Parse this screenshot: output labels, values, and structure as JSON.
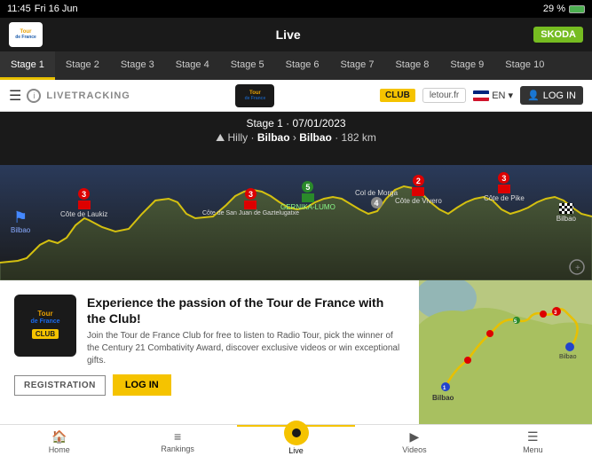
{
  "statusBar": {
    "time": "11:45",
    "day": "Fri 16 Jun",
    "battery": "29 %",
    "signal": "wifi"
  },
  "topNav": {
    "liveLabel": "Live",
    "skodaLabel": "SKODA"
  },
  "stageTabs": {
    "tabs": [
      {
        "label": "Stage 1",
        "active": true
      },
      {
        "label": "Stage 2",
        "active": false
      },
      {
        "label": "Stage 3",
        "active": false
      },
      {
        "label": "Stage 4",
        "active": false
      },
      {
        "label": "Stage 5",
        "active": false
      },
      {
        "label": "Stage 6",
        "active": false
      },
      {
        "label": "Stage 7",
        "active": false
      },
      {
        "label": "Stage 8",
        "active": false
      },
      {
        "label": "Stage 9",
        "active": false
      },
      {
        "label": "Stage 10",
        "active": false
      }
    ]
  },
  "subNav": {
    "livetracking": "LIVETRACKING",
    "club": "CLUB",
    "letour": "letour.fr",
    "lang": "EN",
    "login": "LOG IN"
  },
  "profileSection": {
    "stageInfo": "Stage 1 · 07/01/2023",
    "terrain": "Hilly",
    "from": "Bilbao",
    "to": "Bilbao",
    "distance": "182 km",
    "climbs": [
      {
        "label": "Bilbao",
        "type": "start",
        "left": "3%"
      },
      {
        "label": "Côte de Laukiz",
        "cat": "3",
        "left": "12%"
      },
      {
        "label": "Côte de San Juan de Gaztelugatxe",
        "cat": "3",
        "left": "37%"
      },
      {
        "label": "GERNIKA-LUMO",
        "cat": "s5",
        "left": "47%",
        "type": "sprint"
      },
      {
        "label": "Col de Morga",
        "left": "61%"
      },
      {
        "label": "Côte de Vivero",
        "cat": "2",
        "left": "69%"
      },
      {
        "label": "Côte de Pike",
        "cat": "3",
        "left": "84%"
      },
      {
        "label": "Bilbao",
        "type": "finish",
        "left": "94%"
      }
    ]
  },
  "promo": {
    "title": "Experience the passion of the Tour de France with the Club!",
    "body": "Join the Tour de France Club for free to listen to Radio Tour, pick the winner of the Century 21 Combativity Award, discover exclusive videos or win exceptional gifts.",
    "registrationLabel": "REGISTRATION",
    "loginLabel": "LOG IN"
  },
  "bottomNav": {
    "items": [
      {
        "label": "Home",
        "icon": "🏠",
        "active": false
      },
      {
        "label": "Rankings",
        "icon": "≡",
        "active": false
      },
      {
        "label": "Live",
        "icon": "●",
        "active": true
      },
      {
        "label": "Videos",
        "icon": "▶",
        "active": false
      },
      {
        "label": "Menu",
        "icon": "☰",
        "active": false
      }
    ]
  }
}
